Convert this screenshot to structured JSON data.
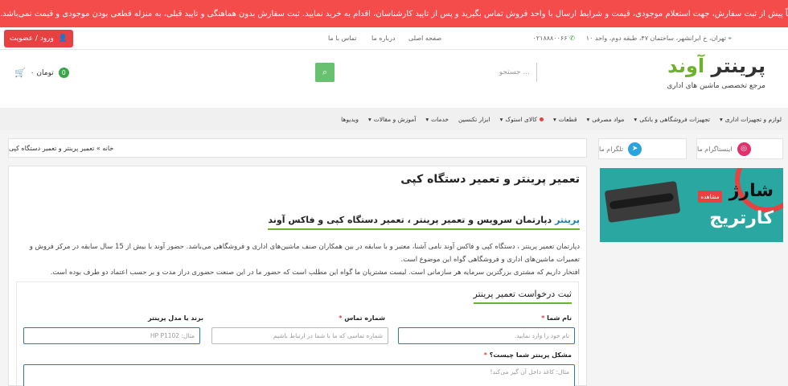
{
  "notice": {
    "icon": "warning-icon",
    "text": "توجه: لطفاً پیش از ثبت سفارش، جهت استعلام موجودی، قیمت و شرایط ارسال با واحد فروش تماس بگیرید و پس از تایید کارشناسان، اقدام به خرید نمایید. ثبت سفارش بدون هماهنگی و تایید قبلی، به منزله قطعی بودن موجودی و قیمت نمی‌باشد."
  },
  "topbar": {
    "login_label": "ورود / عضویت",
    "links": [
      "صفحه اصلی",
      "درباره ما",
      "تماس با ما"
    ],
    "address": "تهران، خ ایرانشهر، ساختمان ۴۷، طبقه دوم، واحد ۱۰",
    "phone": "۰۲۱۸۸۸۰۰۶۶"
  },
  "header": {
    "logo_name_green": "آوند",
    "logo_name_dark": "پرینتر",
    "logo_tagline": "مرجع تخصصی ماشین های اداری",
    "search_placeholder": "جستجو ...",
    "cart_count": "0",
    "cart_total": "۰ تومان"
  },
  "menu": [
    {
      "label": "لوازم و تجهیزات اداری",
      "dropdown": true
    },
    {
      "label": "تجهیزات فروشگاهی و بانکی",
      "dropdown": true
    },
    {
      "label": "مواد مصرفی",
      "dropdown": true
    },
    {
      "label": "قطعات",
      "dropdown": true
    },
    {
      "label": "کالای استوک",
      "dropdown": true,
      "dot": true
    },
    {
      "label": "ابزار تکنسین",
      "dropdown": false
    },
    {
      "label": "خدمات",
      "dropdown": true
    },
    {
      "label": "آموزش و مقالات",
      "dropdown": true
    },
    {
      "label": "ویدیوها",
      "dropdown": false
    }
  ],
  "social": {
    "instagram": "اینستاگرام ما",
    "telegram": "تلگرام ما"
  },
  "breadcrumb": "خانه » تعمیر پرینتر و تعمیر دستگاه کپی",
  "banner": {
    "line1": "شارژ",
    "line2": "کارتریج",
    "watch": "مشاهده"
  },
  "page": {
    "title": "تعمیر پرینتر و تعمیر دستگاه کپی",
    "subtitle_main": "دپارتمان سرویس و تعمیر پرینتر ، تعمیر دستگاه کپی و فاکس آوند",
    "subtitle_link": "پرینتر",
    "para1": "دپارتمان تعمیر پرینتر ، دستگاه کپی و فاکس آوند نامی آشنا، معتبر و با سابقه در بین همکاران صنف ماشین‌های اداری و فروشگاهی می‌باشد. حضور آوند با بیش از 15 سال سابقه در مرکز فروش و تعمیرات ماشین‌های اداری و فروشگاهی گواه این موضوع است.",
    "para2": "افتخار داریم که مشتری بزرگترین سرمایه هر سازمانی است. لیست مشتریان ما گواه این مطلب است که حضور ما در این صنعت حضوری دراز مدت و بر حسب اعتماد دو طرف بوده است."
  },
  "form": {
    "title": "ثبت درخواست تعمیر پرینتر",
    "name_label": "نام شما",
    "name_placeholder": "نام خود را وارد نمایید.",
    "phone_label": "شماره تماس",
    "phone_placeholder": "شماره تماسی که ما با شما در ارتباط باشیم",
    "model_label": "برند یا مدل پرینتر",
    "model_placeholder": "مثال: HP P1102",
    "problem_label": "مشکل پرینتر شما چیست؟",
    "problem_placeholder": "مثال: کاغذ داخل آن گیر می‌کند!"
  },
  "colors": {
    "notice_bg": "#f44b4b",
    "brand_green": "#6db22b",
    "accent_red": "#e74141",
    "link_blue": "#2a7ab0"
  }
}
